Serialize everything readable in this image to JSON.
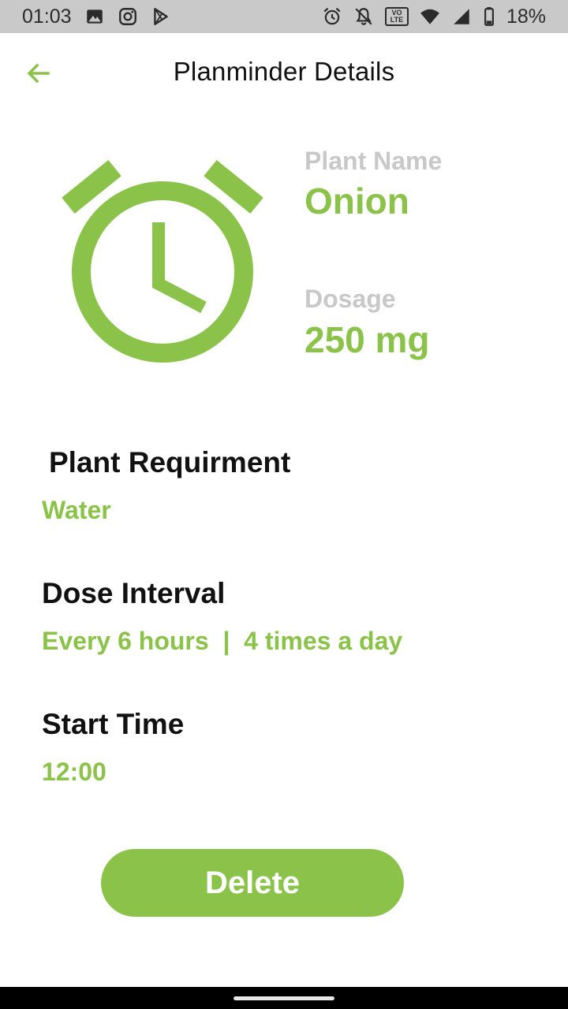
{
  "status_bar": {
    "time": "01:03",
    "battery": "18%",
    "volte_line1": "VO",
    "volte_line2": "LTE",
    "left_icons": [
      "image-icon",
      "instagram-icon",
      "play-store-icon"
    ],
    "right_icons": [
      "alarm-icon",
      "notifications-off-icon",
      "volte-icon",
      "wifi-icon",
      "signal-icon",
      "battery-icon"
    ]
  },
  "app_bar": {
    "title": "Planminder Details",
    "back_icon": "arrow-left-icon"
  },
  "plant": {
    "name_label": "Plant Name",
    "name": "Onion",
    "dosage_label": "Dosage",
    "dosage": "250 mg",
    "illustration_icon": "alarm-clock-icon"
  },
  "requirement": {
    "title": "Plant Requirment",
    "value": "Water"
  },
  "interval": {
    "title": "Dose Interval",
    "value": "Every 6 hours  |  4 times a day"
  },
  "start": {
    "title": "Start Time",
    "value": "12:00"
  },
  "actions": {
    "delete_label": "Delete"
  },
  "colors": {
    "accent": "#8bc34a",
    "label_gray": "#c8c8c8",
    "status_bar": "#c9c9c9",
    "text_dark": "#111111"
  }
}
